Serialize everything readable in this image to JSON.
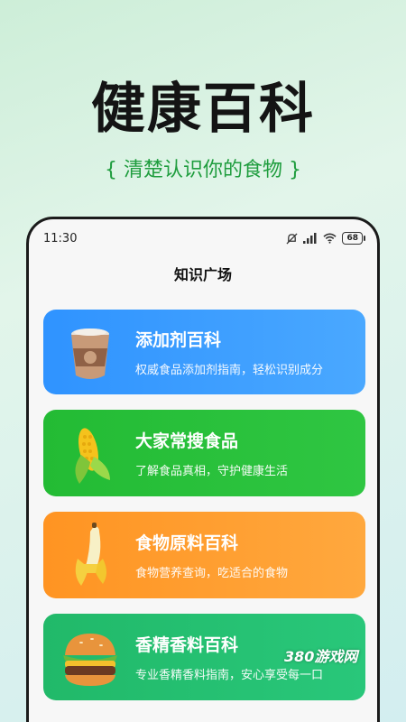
{
  "hero": {
    "title": "健康百科",
    "subtitle": "{ 清楚认识你的食物 }"
  },
  "status_bar": {
    "time": "11:30",
    "battery": "68"
  },
  "page": {
    "title": "知识广场"
  },
  "cards": [
    {
      "title": "添加剂百科",
      "desc": "权威食品添加剂指南，轻松识别成分",
      "icon": "coffee-cup-icon",
      "color": "#3a9cff"
    },
    {
      "title": "大家常搜食品",
      "desc": "了解食品真相，守护健康生活",
      "icon": "corn-icon",
      "color": "#27bf3a"
    },
    {
      "title": "食物原料百科",
      "desc": "食物营养查询，吃适合的食物",
      "icon": "banana-icon",
      "color": "#ff9d30"
    },
    {
      "title": "香精香料百科",
      "desc": "专业香精香料指南，安心享受每一口",
      "icon": "burger-icon",
      "color": "#25bf70"
    }
  ],
  "watermark": "380游戏网"
}
